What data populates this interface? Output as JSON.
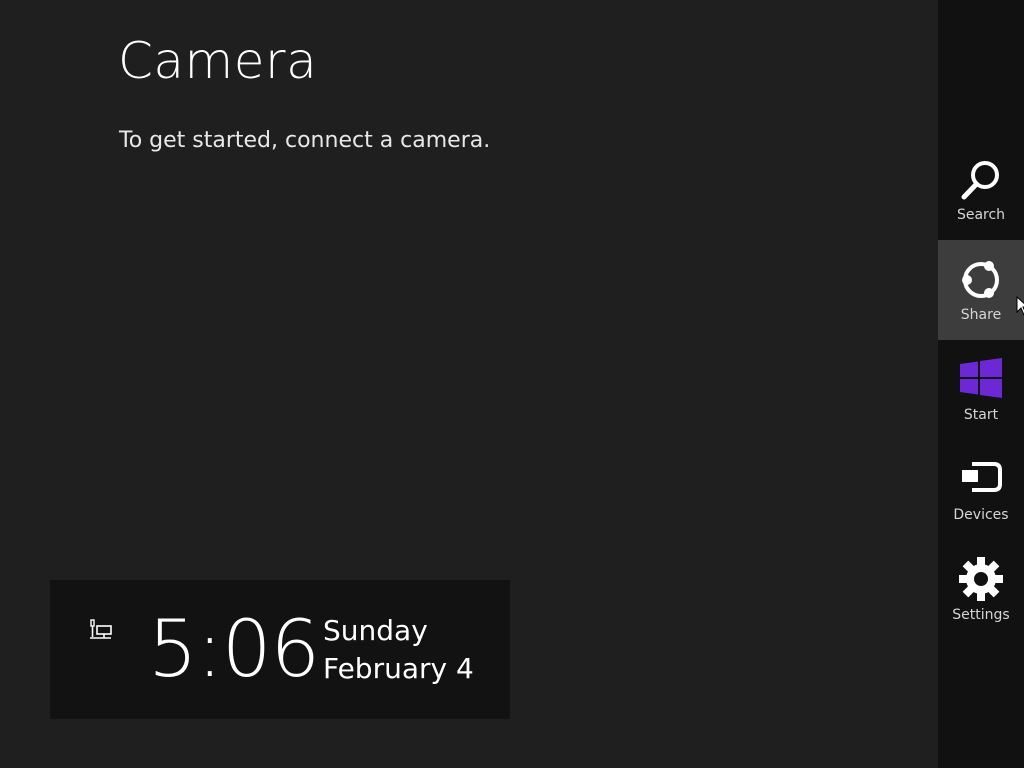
{
  "app": {
    "title": "Camera",
    "message": "To get started, connect a camera."
  },
  "clock": {
    "time": "5:06",
    "day": "Sunday",
    "date": "February 4",
    "network_icon": "network-icon"
  },
  "charms": {
    "items": [
      {
        "label": "Search",
        "icon": "search-icon"
      },
      {
        "label": "Share",
        "icon": "share-icon",
        "active": true
      },
      {
        "label": "Start",
        "icon": "windows-logo-icon"
      },
      {
        "label": "Devices",
        "icon": "devices-icon"
      },
      {
        "label": "Settings",
        "icon": "gear-icon"
      }
    ]
  },
  "colors": {
    "background": "#1f1f1f",
    "charms_bar": "#111111",
    "charm_active": "#3d3d3d",
    "clock_panel": "#121212",
    "start_logo": "#6b28d4"
  }
}
